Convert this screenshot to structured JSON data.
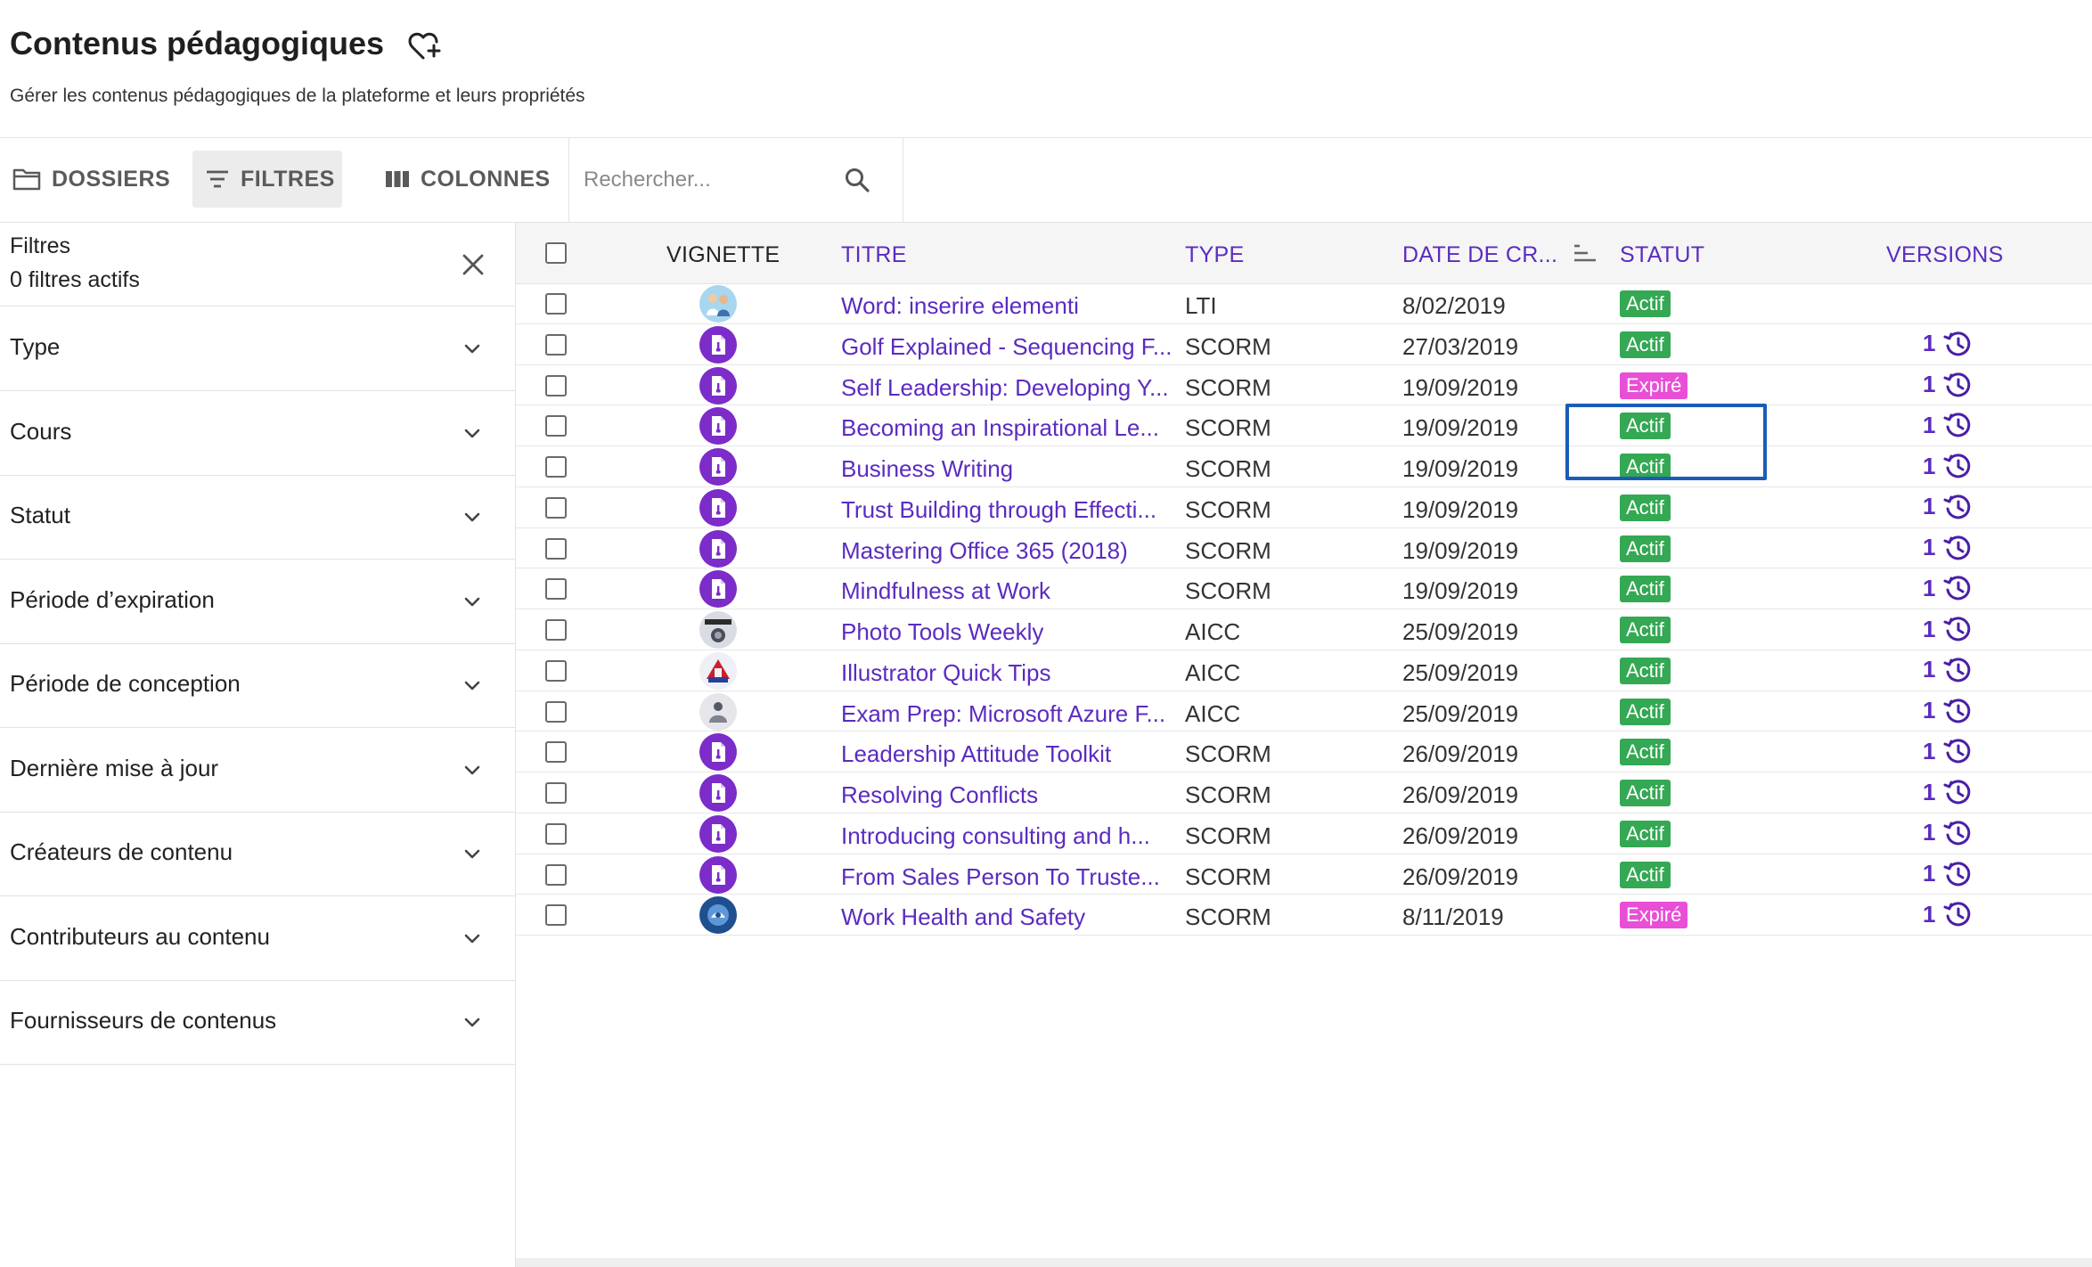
{
  "header": {
    "title": "Contenus pédagogiques",
    "subtitle": "Gérer les contenus pédagogiques de la plateforme et leurs propriétés"
  },
  "toolbar": {
    "folders_label": "DOSSIERS",
    "filters_label": "FILTRES",
    "columns_label": "COLONNES",
    "search_placeholder": "Rechercher..."
  },
  "filters": {
    "title": "Filtres",
    "active_count_text": "0 filtres actifs",
    "items": [
      "Type",
      "Cours",
      "Statut",
      "Période d’expiration",
      "Période de conception",
      "Dernière mise à jour",
      "Créateurs de contenu",
      "Contributeurs au contenu",
      "Fournisseurs de contenus"
    ]
  },
  "table": {
    "columns": {
      "thumbnail": "VIGNETTE",
      "title": "TITRE",
      "type": "TYPE",
      "date": "DATE DE CR...",
      "status": "STATUT",
      "versions": "VERSIONS"
    },
    "rows": [
      {
        "thumb": "avatar-people",
        "title": "Word: inserire elementi",
        "type": "LTI",
        "date": "8/02/2019",
        "status": "Actif",
        "versions": ""
      },
      {
        "thumb": "scorm-package",
        "title": "Golf Explained - Sequencing F...",
        "type": "SCORM",
        "date": "27/03/2019",
        "status": "Actif",
        "versions": "1"
      },
      {
        "thumb": "scorm-package",
        "title": "Self Leadership: Developing Y...",
        "type": "SCORM",
        "date": "19/09/2019",
        "status": "Expiré",
        "versions": "1"
      },
      {
        "thumb": "scorm-package",
        "title": "Becoming an Inspirational Le...",
        "type": "SCORM",
        "date": "19/09/2019",
        "status": "Actif",
        "versions": "1"
      },
      {
        "thumb": "scorm-package",
        "title": "Business Writing",
        "type": "SCORM",
        "date": "19/09/2019",
        "status": "Actif",
        "versions": "1"
      },
      {
        "thumb": "scorm-package",
        "title": "Trust Building through Effecti...",
        "type": "SCORM",
        "date": "19/09/2019",
        "status": "Actif",
        "versions": "1"
      },
      {
        "thumb": "scorm-package",
        "title": "Mastering Office 365 (2018)",
        "type": "SCORM",
        "date": "19/09/2019",
        "status": "Actif",
        "versions": "1"
      },
      {
        "thumb": "scorm-package",
        "title": "Mindfulness at Work",
        "type": "SCORM",
        "date": "19/09/2019",
        "status": "Actif",
        "versions": "1"
      },
      {
        "thumb": "photo-tools",
        "title": "Photo Tools Weekly",
        "type": "AICC",
        "date": "25/09/2019",
        "status": "Actif",
        "versions": "1"
      },
      {
        "thumb": "illustrator",
        "title": "Illustrator Quick Tips",
        "type": "AICC",
        "date": "25/09/2019",
        "status": "Actif",
        "versions": "1"
      },
      {
        "thumb": "exam-prep",
        "title": "Exam Prep: Microsoft Azure F...",
        "type": "AICC",
        "date": "25/09/2019",
        "status": "Actif",
        "versions": "1"
      },
      {
        "thumb": "scorm-package",
        "title": "Leadership Attitude Toolkit",
        "type": "SCORM",
        "date": "26/09/2019",
        "status": "Actif",
        "versions": "1"
      },
      {
        "thumb": "scorm-package",
        "title": "Resolving Conflicts",
        "type": "SCORM",
        "date": "26/09/2019",
        "status": "Actif",
        "versions": "1"
      },
      {
        "thumb": "scorm-package",
        "title": "Introducing consulting and h...",
        "type": "SCORM",
        "date": "26/09/2019",
        "status": "Actif",
        "versions": "1"
      },
      {
        "thumb": "scorm-package",
        "title": "From Sales Person To Truste...",
        "type": "SCORM",
        "date": "26/09/2019",
        "status": "Actif",
        "versions": "1"
      },
      {
        "thumb": "health-safety",
        "title": "Work Health and Safety",
        "type": "SCORM",
        "date": "8/11/2019",
        "status": "Expiré",
        "versions": "1"
      }
    ]
  },
  "colors": {
    "accent": "#5b2bc0",
    "status_active": "#34a853",
    "status_expired": "#e84fd6",
    "highlight": "#1b5cb7"
  }
}
